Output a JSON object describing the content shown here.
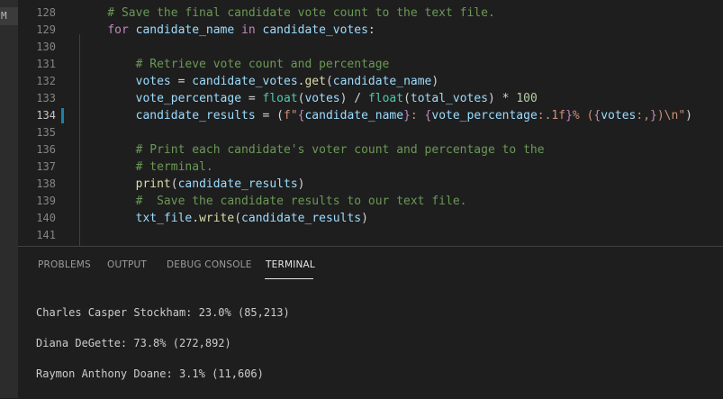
{
  "side_marker": "M",
  "editor": {
    "lines": [
      {
        "n": "128",
        "tokens": [
          {
            "t": "    # Save the final candidate vote count to the text file.",
            "c": "cm"
          }
        ]
      },
      {
        "n": "129",
        "tokens": [
          {
            "t": "    "
          },
          {
            "t": "for",
            "c": "kw"
          },
          {
            "t": " "
          },
          {
            "t": "candidate_name",
            "c": "var"
          },
          {
            "t": " "
          },
          {
            "t": "in",
            "c": "kw"
          },
          {
            "t": " "
          },
          {
            "t": "candidate_votes",
            "c": "var"
          },
          {
            "t": ":"
          }
        ]
      },
      {
        "n": "130",
        "tokens": []
      },
      {
        "n": "131",
        "tokens": [
          {
            "t": "        # Retrieve vote count and percentage",
            "c": "cm"
          }
        ]
      },
      {
        "n": "132",
        "tokens": [
          {
            "t": "        "
          },
          {
            "t": "votes",
            "c": "var"
          },
          {
            "t": " = "
          },
          {
            "t": "candidate_votes",
            "c": "var"
          },
          {
            "t": "."
          },
          {
            "t": "get",
            "c": "fn"
          },
          {
            "t": "("
          },
          {
            "t": "candidate_name",
            "c": "var"
          },
          {
            "t": ")"
          }
        ]
      },
      {
        "n": "133",
        "tokens": [
          {
            "t": "        "
          },
          {
            "t": "vote_percentage",
            "c": "var"
          },
          {
            "t": " = "
          },
          {
            "t": "float",
            "c": "bi"
          },
          {
            "t": "("
          },
          {
            "t": "votes",
            "c": "var"
          },
          {
            "t": ") / "
          },
          {
            "t": "float",
            "c": "bi"
          },
          {
            "t": "("
          },
          {
            "t": "total_votes",
            "c": "var"
          },
          {
            "t": ") * "
          },
          {
            "t": "100",
            "c": "num"
          }
        ]
      },
      {
        "n": "134",
        "active": true,
        "tokens": [
          {
            "t": "        "
          },
          {
            "t": "candidate_results",
            "c": "var"
          },
          {
            "t": " = ("
          },
          {
            "t": "f\"",
            "c": "str"
          },
          {
            "t": "{",
            "c": "kw"
          },
          {
            "t": "candidate_name",
            "c": "var"
          },
          {
            "t": "}",
            "c": "kw"
          },
          {
            "t": ": ",
            "c": "str"
          },
          {
            "t": "{",
            "c": "kw"
          },
          {
            "t": "vote_percentage",
            "c": "var"
          },
          {
            "t": ":.1f",
            "c": "str"
          },
          {
            "t": "}",
            "c": "kw"
          },
          {
            "t": "% (",
            "c": "str"
          },
          {
            "t": "{",
            "c": "kw"
          },
          {
            "t": "votes",
            "c": "var"
          },
          {
            "t": ":,",
            "c": "str"
          },
          {
            "t": "}",
            "c": "kw"
          },
          {
            "t": ")\\n\"",
            "c": "str"
          },
          {
            "t": ")"
          }
        ]
      },
      {
        "n": "135",
        "tokens": []
      },
      {
        "n": "136",
        "tokens": [
          {
            "t": "        # Print each candidate's voter count and percentage to the",
            "c": "cm"
          }
        ]
      },
      {
        "n": "137",
        "tokens": [
          {
            "t": "        # terminal.",
            "c": "cm"
          }
        ]
      },
      {
        "n": "138",
        "tokens": [
          {
            "t": "        "
          },
          {
            "t": "print",
            "c": "fn"
          },
          {
            "t": "("
          },
          {
            "t": "candidate_results",
            "c": "var"
          },
          {
            "t": ")"
          }
        ]
      },
      {
        "n": "139",
        "tokens": [
          {
            "t": "        #  Save the candidate results to our text file.",
            "c": "cm"
          }
        ]
      },
      {
        "n": "140",
        "tokens": [
          {
            "t": "        "
          },
          {
            "t": "txt_file",
            "c": "var"
          },
          {
            "t": "."
          },
          {
            "t": "write",
            "c": "fn"
          },
          {
            "t": "("
          },
          {
            "t": "candidate_results",
            "c": "var"
          },
          {
            "t": ")"
          }
        ]
      },
      {
        "n": "141",
        "tokens": []
      }
    ]
  },
  "panel": {
    "tabs": {
      "problems": "PROBLEMS",
      "output": "OUTPUT",
      "debug_console": "DEBUG CONSOLE",
      "terminal": "TERMINAL"
    },
    "terminal_lines": [
      "Charles Casper Stockham: 23.0% (85,213)",
      "Diana DeGette: 73.8% (272,892)",
      "Raymon Anthony Doane: 3.1% (11,606)"
    ]
  },
  "colors": {
    "background": "#1e1e1e",
    "line_number": "#858585",
    "comment": "#6a9955",
    "keyword": "#c586c0",
    "variable": "#9cdcfe",
    "function": "#dcdcaa",
    "string": "#ce9178",
    "number": "#b5cea8",
    "modified_gutter": "#1b81a8"
  }
}
